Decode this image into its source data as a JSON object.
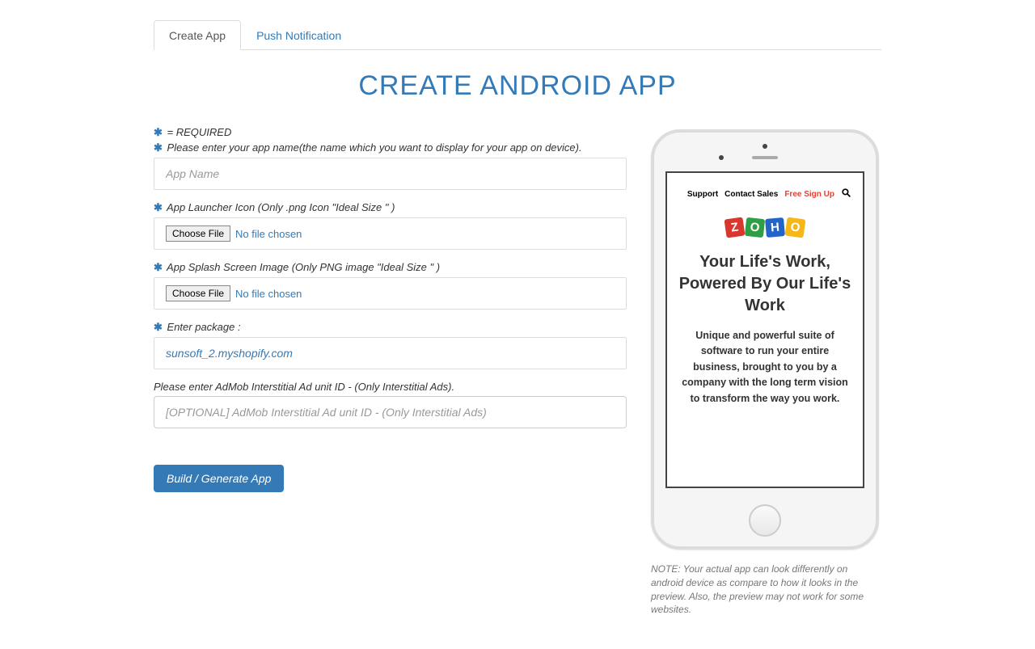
{
  "tabs": {
    "create_app": "Create App",
    "push_notification": "Push Notification"
  },
  "page_title": "CREATE ANDROID APP",
  "required_legend": "= REQUIRED",
  "fields": {
    "app_name_label": "Please enter your app name(the name which you want to display for your app on device).",
    "app_name_placeholder": "App Name",
    "launcher_label": "App Launcher Icon (Only .png Icon \"Ideal Size \" )",
    "choose_file_btn": "Choose File",
    "no_file_chosen": "No file chosen",
    "splash_label": "App Splash Screen Image (Only PNG image \"Ideal Size \" )",
    "package_label": "Enter package :",
    "package_value": "sunsoft_2.myshopify.com",
    "admob_label": "Please enter AdMob Interstitial Ad unit ID - (Only Interstitial Ads).",
    "admob_placeholder": "[OPTIONAL] AdMob Interstitial Ad unit ID - (Only Interstitial Ads)"
  },
  "build_button": "Build / Generate App",
  "preview": {
    "support": "Support",
    "contact": "Contact Sales",
    "signup": "Free Sign Up",
    "logo_letters": [
      "Z",
      "O",
      "H",
      "O"
    ],
    "heading": "Your Life's Work, Powered By Our Life's Work",
    "paragraph": "Unique and powerful suite of software to run your entire business, brought to you by a company with the long term vision to transform the way you work.",
    "note": "NOTE: Your actual app can look differently on android device as compare to how it looks in the preview. Also, the preview may not work for some websites."
  }
}
